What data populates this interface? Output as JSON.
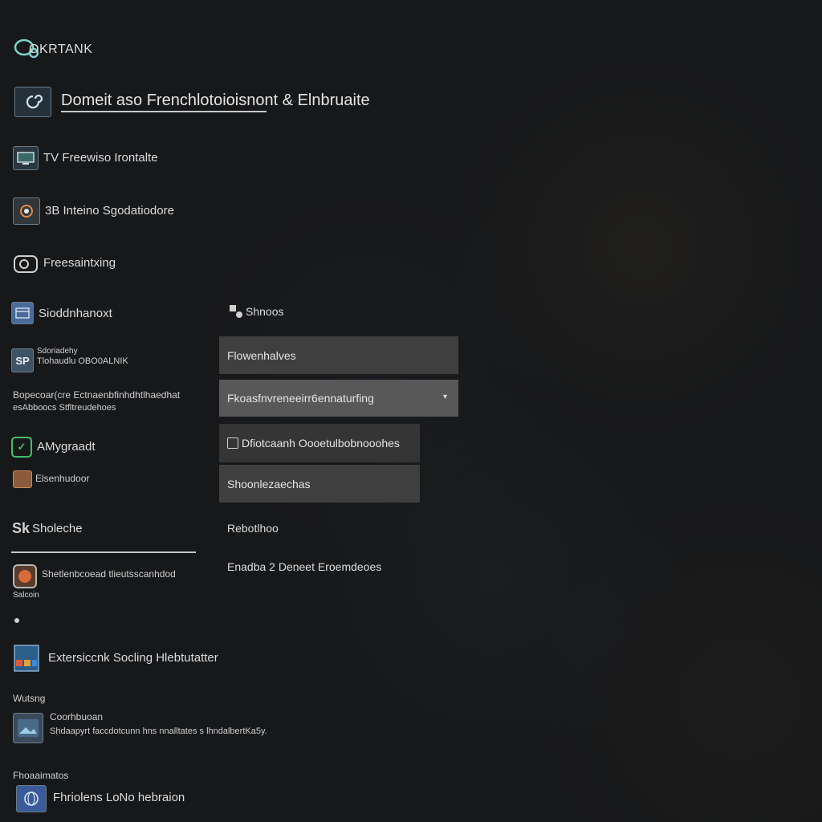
{
  "app": {
    "brand": "OKRTANK"
  },
  "header": {
    "title": "Domeit aso Frenchlotoioisnont & Elnbruaite"
  },
  "sidebar": {
    "items": [
      {
        "label": "TV Freewiso Irontalte",
        "icon": "monitor-icon"
      },
      {
        "label": "3B Inteino Sgodatiodore",
        "icon": "camera-icon"
      },
      {
        "label": "Freesaintxing",
        "icon": "disc-icon"
      },
      {
        "label": "Sioddnhanoxt",
        "icon": "window-icon"
      },
      {
        "label_line1": "Sdoriadehy",
        "label_line2": "Tlohaudlu OBO0ALNIK",
        "icon": "sp-icon"
      },
      {
        "label_line1": "Bopecoar(cre Ectnaenbfinhdhtlhaedhat",
        "label_line2": "esAbboocs Stfltreudehoes"
      },
      {
        "label": "AMygraadt",
        "icon": "green-app-icon"
      },
      {
        "label": "Elsenhudoor",
        "icon": "folder-icon"
      },
      {
        "label": "Sholeche",
        "icon": "sk-icon"
      },
      {
        "label": "Shetlenbcoead tlieutsscanhdod",
        "sub": "Salcoin",
        "icon": "orange-app-icon"
      },
      {
        "label": "Extersiccnk Socling Hlebtutatter",
        "icon": "tiles-icon"
      },
      {
        "label": "Wutsng"
      },
      {
        "label": "Coorhbuoan",
        "sub": "Shdaapyrt faccdotcunn hns nnalltates s lhndalbertKa5y.",
        "icon": "image-icon"
      },
      {
        "label": "Fhoaaimatos"
      },
      {
        "label": "Fhriolens LoNo hebraion",
        "icon": "globe-icon"
      }
    ]
  },
  "panel": {
    "section_title": "Shnoos",
    "menu": [
      "Flowenhalves",
      "Fkoasfnvreneeirr6ennaturfing",
      "Dfiotcaanh Oooetulbobnooohes",
      "Shoonlezaechas"
    ],
    "label1": "Rebotlhoo",
    "label2": "Enadba 2 Deneet Eroemdeoes"
  },
  "colors": {
    "background": "#17181a",
    "menu_light": "#555555",
    "menu_dark": "#3a3a3a",
    "accent": "#7ad0c9"
  }
}
